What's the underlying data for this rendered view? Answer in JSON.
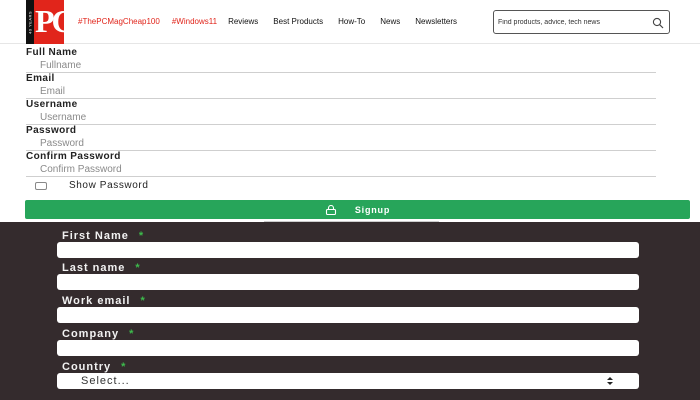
{
  "header": {
    "logo_text": "PC",
    "logo_side_text": "40 YEARS",
    "nav": [
      {
        "label": "#ThePCMagCheap100",
        "hot": true
      },
      {
        "label": "#Windows11",
        "hot": true
      },
      {
        "label": "Reviews",
        "hot": false
      },
      {
        "label": "Best Products",
        "hot": false
      },
      {
        "label": "How-To",
        "hot": false
      },
      {
        "label": "News",
        "hot": false
      },
      {
        "label": "Newsletters",
        "hot": false
      }
    ],
    "search_placeholder": "Find products, advice, tech news"
  },
  "signup_form": {
    "fields": [
      {
        "label": "Full Name",
        "placeholder": "Fullname"
      },
      {
        "label": "Email",
        "placeholder": "Email"
      },
      {
        "label": "Username",
        "placeholder": "Username"
      },
      {
        "label": "Password",
        "placeholder": "Password"
      },
      {
        "label": "Confirm Password",
        "placeholder": "Confirm Password"
      }
    ],
    "show_password_label": "Show Password",
    "signup_label": "Signup"
  },
  "contact_form": {
    "required_mark": "*",
    "fields": [
      {
        "label": "First Name"
      },
      {
        "label": "Last name"
      },
      {
        "label": "Work email"
      },
      {
        "label": "Company"
      }
    ],
    "country_label": "Country",
    "country_value": "Select..."
  },
  "colors": {
    "brand_red": "#e1251b",
    "signup_green": "#27a55a",
    "dark_bg": "#342b2d",
    "required_green": "#3dbb4c"
  }
}
